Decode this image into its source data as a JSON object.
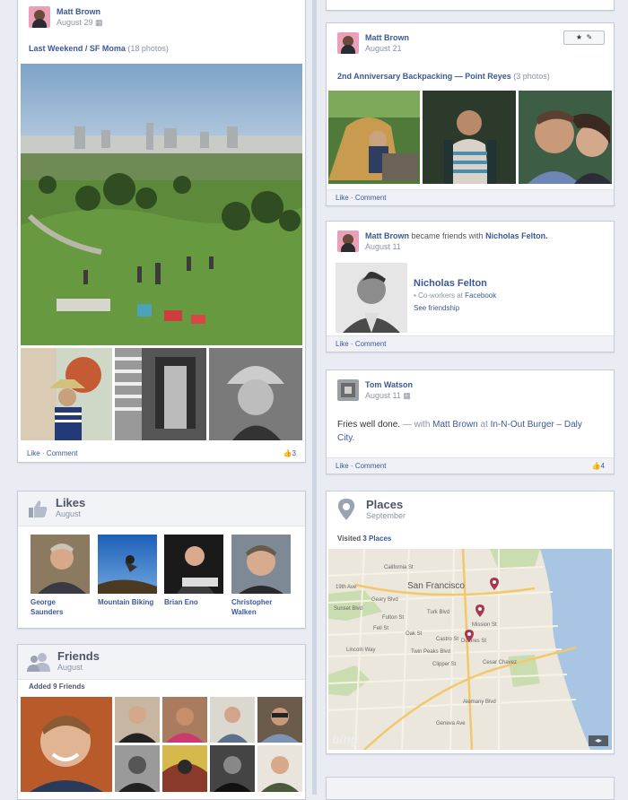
{
  "colors": {
    "link": "#3b5998",
    "muted": "#8a93a6",
    "background": "#e9ecf2",
    "card_border": "#c5ccd8"
  },
  "posts": {
    "left_album": {
      "author": "Matt Brown",
      "date": "August 29",
      "album_title": "Last Weekend / SF Moma",
      "album_count": "(18 photos)",
      "like_label": "Like",
      "comment_label": "Comment",
      "separator": "·",
      "like_count": "3"
    },
    "right_album": {
      "author": "Matt Brown",
      "date": "August 21",
      "album_title": "2nd Anniversary Backpacking — Point Reyes",
      "album_count": "(3 photos)",
      "like_label": "Like",
      "comment_label": "Comment",
      "separator": "·"
    },
    "friendship": {
      "author": "Matt Brown",
      "action": "became friends with",
      "friend": "Nicholas Felton.",
      "date": "August 11",
      "friend_name": "Nicholas Felton",
      "friend_detail_prefix": "Co-workers at",
      "friend_detail_org": "Facebook",
      "see_friendship": "See friendship",
      "like_label": "Like",
      "comment_label": "Comment",
      "separator": "·"
    },
    "checkin": {
      "author": "Tom Watson",
      "date": "August 11",
      "status": "Fries well done.",
      "with_text": "— with",
      "with_name": "Matt Brown",
      "at_text": "at",
      "place": "In-N-Out Burger – Daly City.",
      "like_label": "Like",
      "comment_label": "Comment",
      "separator": "·",
      "like_count": "4"
    }
  },
  "likes": {
    "title": "Likes",
    "subtitle": "August",
    "items": [
      {
        "name": "George Saunders"
      },
      {
        "name": "Mountain Biking"
      },
      {
        "name": "Brian Eno"
      },
      {
        "name": "Christopher Walken"
      }
    ]
  },
  "places": {
    "title": "Places",
    "subtitle": "September",
    "visited_prefix": "Visited",
    "visited_link": "3 Places",
    "map_labels": [
      "San Francisco",
      "California St",
      "Geary Blvd",
      "Turk Blvd",
      "Oak St",
      "Fell St",
      "Fulton St",
      "Lincoln Way",
      "Twin Peaks Blvd",
      "Clipper St",
      "Cesar Chavez",
      "Mission St",
      "Castro St",
      "Dolores St",
      "19th Ave",
      "Sunset Blvd",
      "Alemany Blvd",
      "Geneva Ave"
    ],
    "map_brand": "bing"
  },
  "friends": {
    "title": "Friends",
    "subtitle": "August",
    "added_text": "Added 9 Friends"
  }
}
